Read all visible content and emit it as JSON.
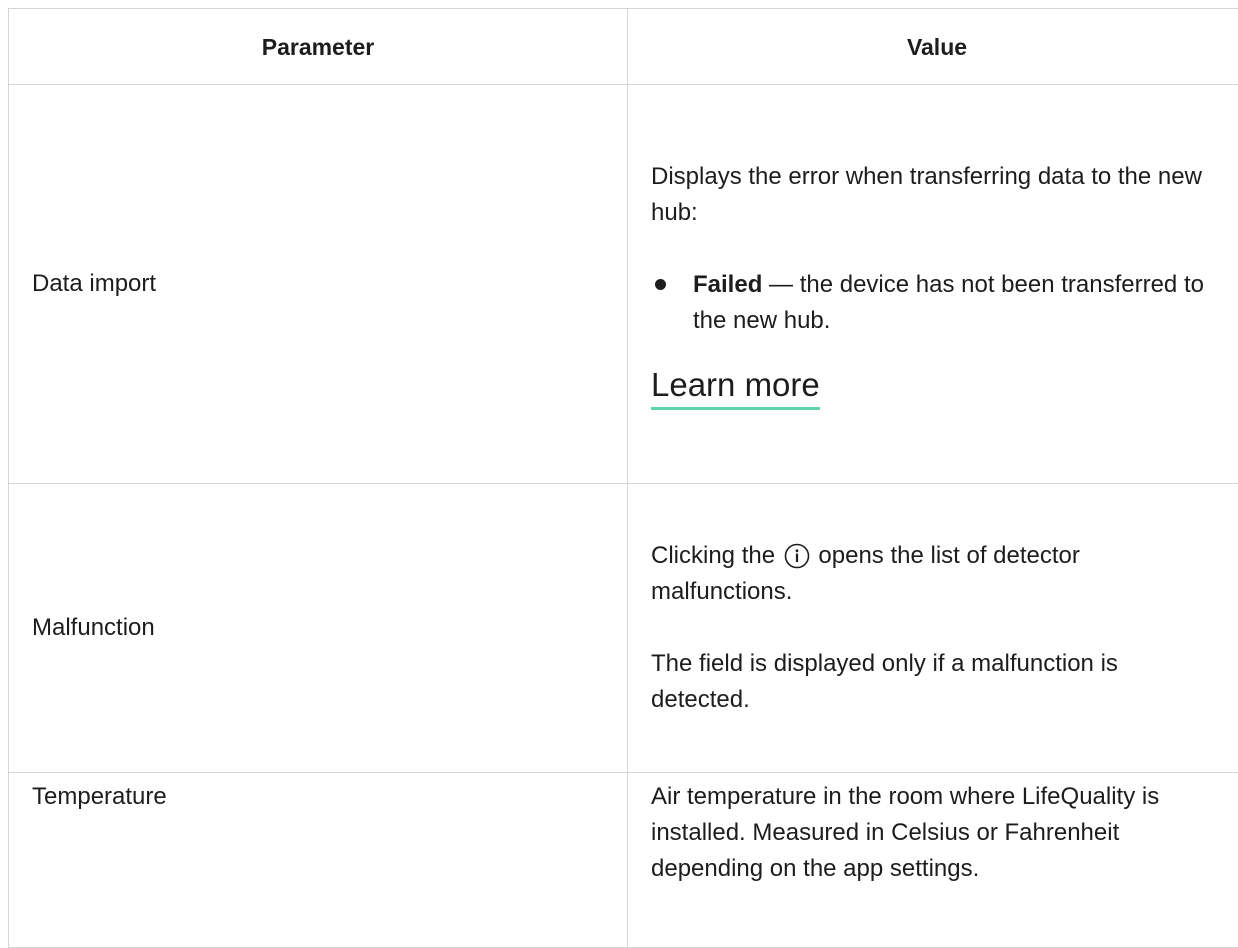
{
  "table": {
    "headers": {
      "parameter": "Parameter",
      "value": "Value"
    },
    "rows": [
      {
        "parameter": "Data import",
        "intro": "Displays the error when transferring data to the new hub:",
        "bullet_strong": "Failed",
        "bullet_rest": " — the device has not been transferred to the new hub.",
        "link_label": "Learn more"
      },
      {
        "parameter": "Malfunction",
        "text_before_icon": "Clicking the ",
        "text_after_icon": " opens the list of detector malfunctions.",
        "note": "The field is displayed only if a malfunction is detected.",
        "icon": "info-icon"
      },
      {
        "parameter": "Temperature",
        "text": "Air temperature in the room where LifeQuality is installed. Measured in Celsius or Fahrenheit depending on the app settings."
      }
    ]
  },
  "colors": {
    "link_underline": "#5fd3ab",
    "border": "#d6d6d6",
    "text": "#1d1d1d"
  }
}
